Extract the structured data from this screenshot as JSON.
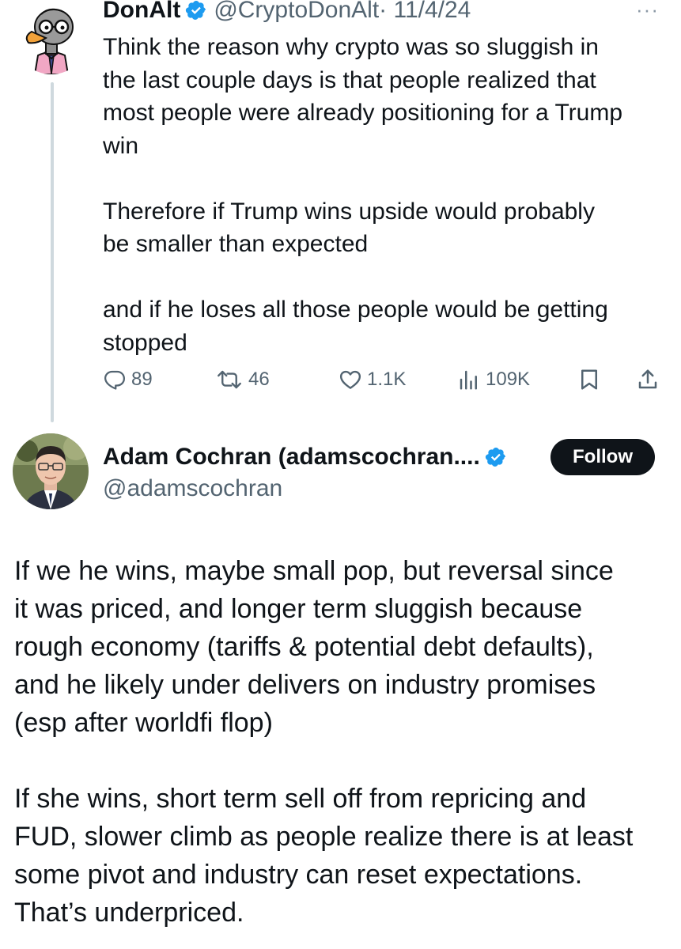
{
  "tweet1": {
    "author_name": "DonAlt",
    "author_handle": "@CryptoDonAlt",
    "date": "· 11/4/24",
    "more_label": "···",
    "paragraphs": [
      "Think the reason why crypto was so sluggish in\nthe last couple days is that people realized that\nmost people were already positioning for a Trump\nwin",
      "Therefore if Trump wins upside would probably\nbe smaller than expected",
      "and if he loses all those people would be getting\nstopped"
    ],
    "stats": {
      "replies": "89",
      "reposts": "46",
      "likes": "1.1K",
      "views": "109K"
    }
  },
  "tweet2": {
    "author_name": "Adam Cochran (adamscochran....",
    "author_handle": "@adamscochran",
    "follow_label": "Follow",
    "paragraphs": [
      "If we he wins, maybe small pop, but reversal since\nit was priced, and longer term sluggish because\nrough economy (tariffs & potential debt defaults),\nand he likely under delivers on industry promises\n(esp after worldfi flop)",
      "If she wins, short term sell off from repricing and\nFUD, slower climb as people realize there is at least\nsome pivot and industry can reset expectations.\nThat’s underpriced."
    ]
  },
  "icons": {
    "reply": "reply-icon",
    "repost": "repost-icon",
    "like": "heart-icon",
    "views": "views-icon",
    "bookmark": "bookmark-icon",
    "share": "share-icon",
    "verified": "verified-badge-icon"
  },
  "colors": {
    "text": "#0f1419",
    "secondary": "#536471",
    "verified_blue": "#1d9bf0",
    "follow_bg": "#0f1419",
    "thread_line": "#cfd9de"
  }
}
